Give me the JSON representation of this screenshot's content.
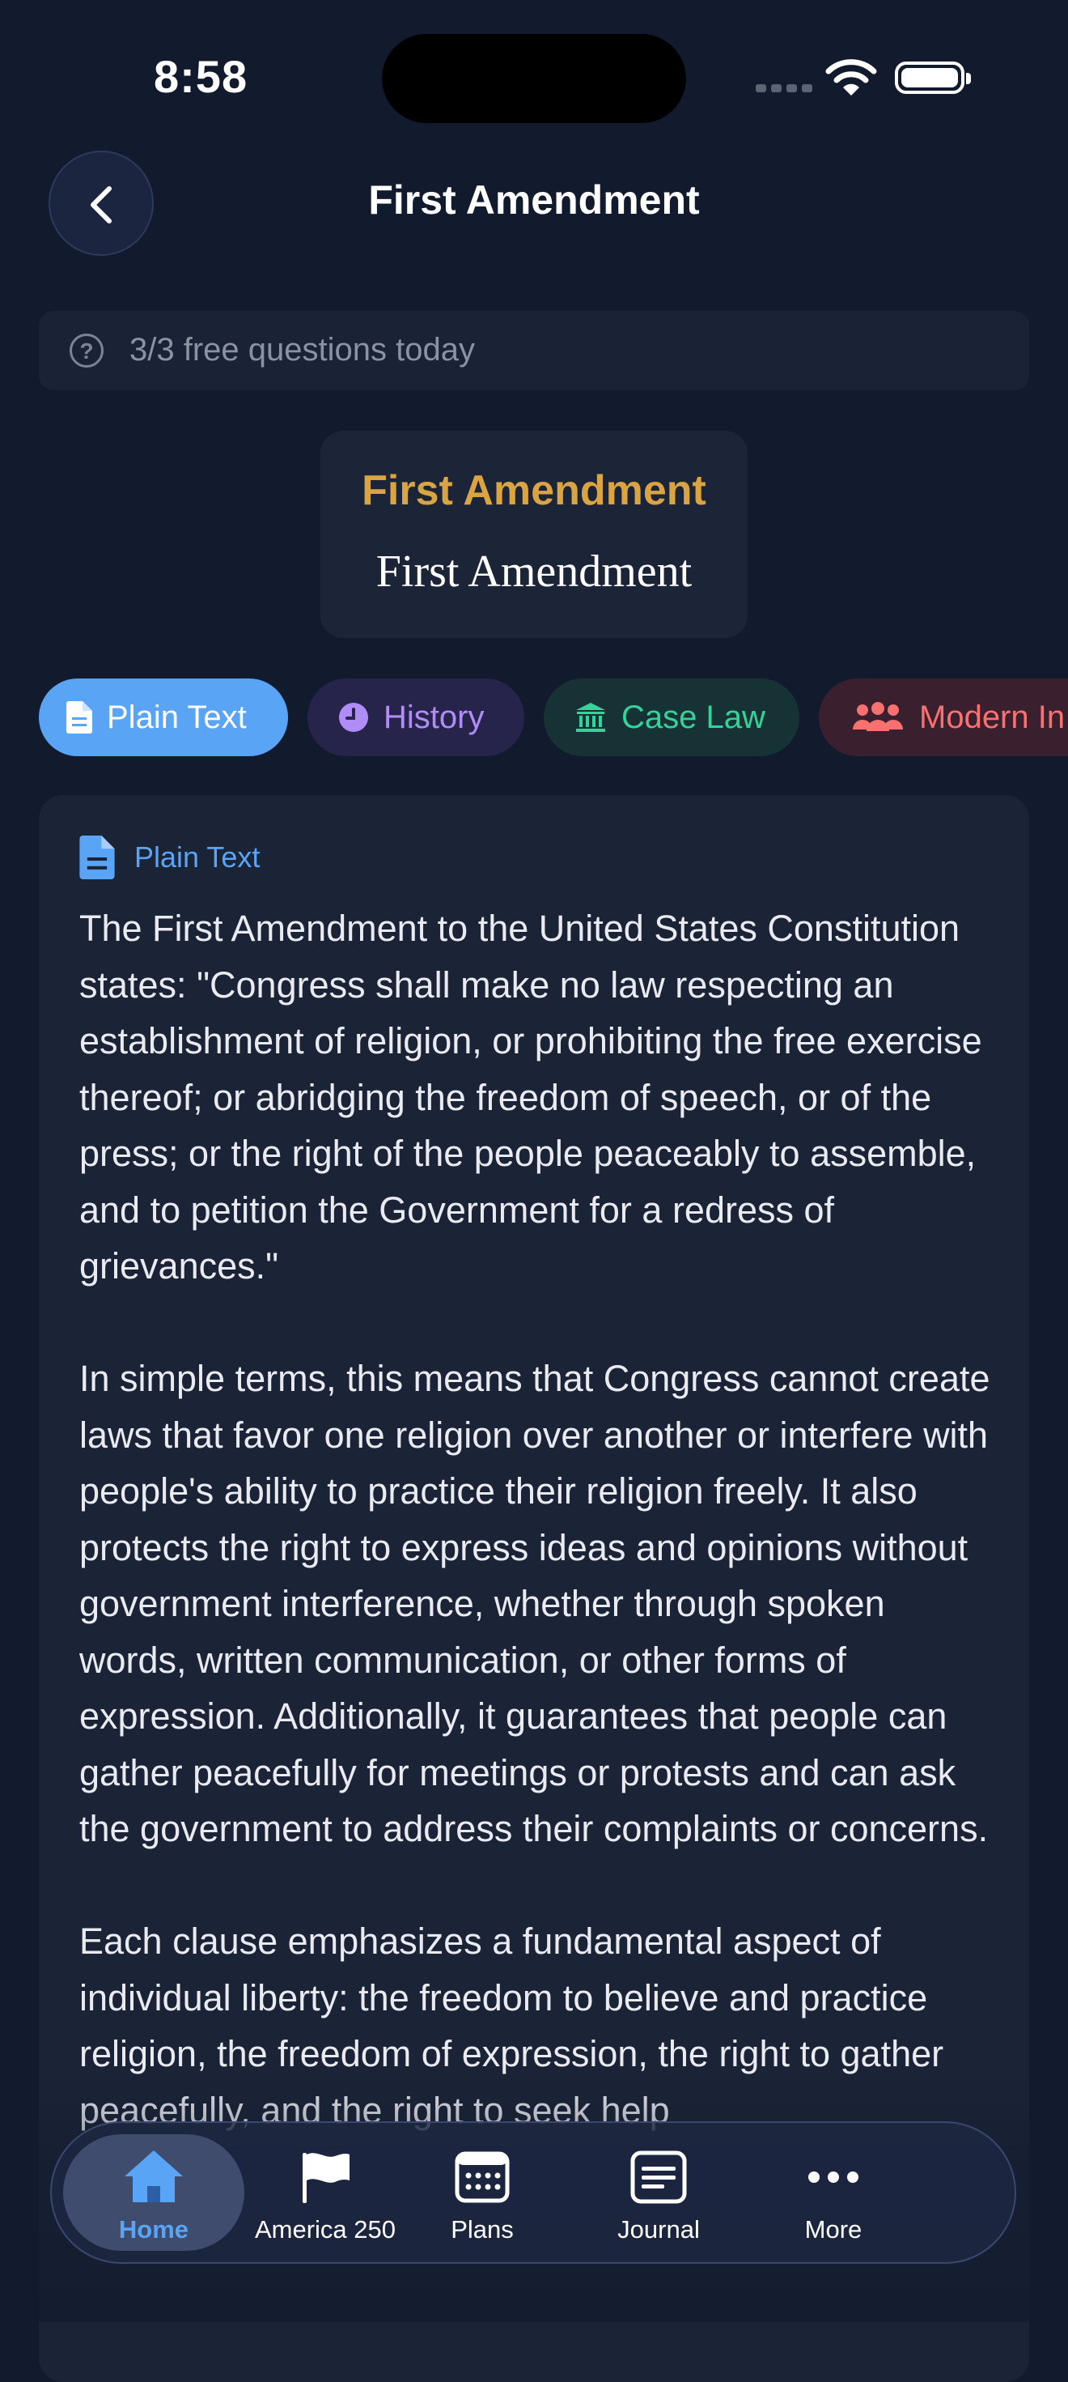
{
  "status_bar": {
    "time": "8:58"
  },
  "header": {
    "title": "First Amendment",
    "back_icon": "chevron-left-icon"
  },
  "quota": {
    "text": "3/3 free questions today",
    "icon": "question-circle-icon"
  },
  "title_card": {
    "title": "First Amendment",
    "subtitle": "First Amendment"
  },
  "tabs": [
    {
      "label": "Plain Text",
      "icon": "document-icon",
      "active": true
    },
    {
      "label": "History",
      "icon": "clock-icon",
      "active": false
    },
    {
      "label": "Case Law",
      "icon": "bank-icon",
      "active": false
    },
    {
      "label": "Modern In",
      "icon": "users-icon",
      "active": false
    }
  ],
  "content": {
    "section_label": "Plain Text",
    "paragraphs": [
      "The First Amendment to the United States Constitution states: \"Congress shall make no law respecting an establishment of religion, or prohibiting the free exercise thereof; or abridging the freedom of speech, or of the press; or the right of the people peaceably to assemble, and to petition the Government for a redress of grievances.\"",
      "In simple terms, this means that Congress cannot create laws that favor one religion over another or interfere with people's ability to practice their religion freely. It also protects the right to express ideas and opinions without government interference, whether through spoken words, written communication, or other forms of expression. Additionally, it guarantees that people can gather peacefully for meetings or protests and can ask the government to address their complaints or concerns.",
      "Each clause emphasizes a fundamental aspect of individual liberty: the freedom to believe and practice religion, the freedom of expression, the right to gather peacefully, and the right to seek help"
    ]
  },
  "bottom_nav": {
    "items": [
      {
        "label": "Home",
        "icon": "home-icon",
        "active": true
      },
      {
        "label": "America 250",
        "icon": "flag-icon",
        "active": false
      },
      {
        "label": "Plans",
        "icon": "calendar-icon",
        "active": false
      },
      {
        "label": "Journal",
        "icon": "journal-icon",
        "active": false
      },
      {
        "label": "More",
        "icon": "more-icon",
        "active": false
      }
    ]
  },
  "colors": {
    "background": "#121a2e",
    "accent_blue": "#5aa4f5",
    "gold": "#d9a441",
    "history_purple": "#b08cf6",
    "case_law_green": "#34d399",
    "modern_red": "#f87171"
  }
}
